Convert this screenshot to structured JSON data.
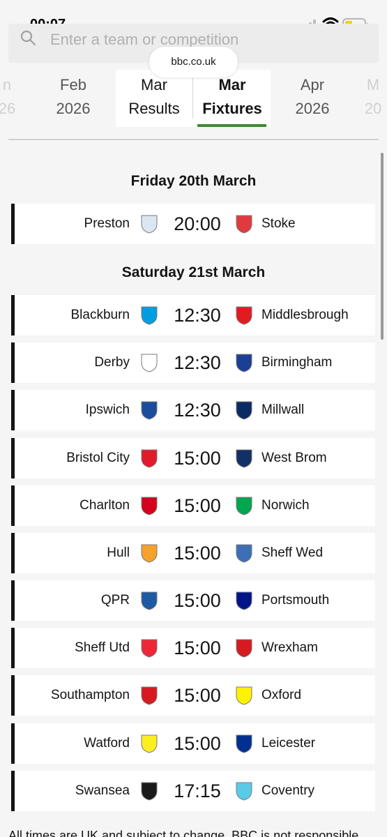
{
  "status_bar": {
    "time": "00:07"
  },
  "search": {
    "placeholder": "Enter a team or competition"
  },
  "browser": {
    "url": "bbc.co.uk"
  },
  "month_tabs": [
    {
      "line1": "n",
      "line2": "26"
    },
    {
      "line1": "Feb",
      "line2": "2026"
    },
    {
      "line1": "Mar",
      "line2": "Results"
    },
    {
      "line1": "Mar",
      "line2": "Fixtures"
    },
    {
      "line1": "Apr",
      "line2": "2026"
    },
    {
      "line1": "M",
      "line2": "20"
    }
  ],
  "days": [
    {
      "heading": "Friday 20th March",
      "fixtures": [
        {
          "home": "Preston",
          "time": "20:00",
          "away": "Stoke",
          "home_crest": "#dbe6f2",
          "away_crest": "#e03a3e"
        }
      ]
    },
    {
      "heading": "Saturday 21st March",
      "fixtures": [
        {
          "home": "Blackburn",
          "time": "12:30",
          "away": "Middlesbrough",
          "home_crest": "#009ee0",
          "away_crest": "#e11b22"
        },
        {
          "home": "Derby",
          "time": "12:30",
          "away": "Birmingham",
          "home_crest": "#ffffff",
          "away_crest": "#1b3f94"
        },
        {
          "home": "Ipswich",
          "time": "12:30",
          "away": "Millwall",
          "home_crest": "#1c4d9c",
          "away_crest": "#0b2a63"
        },
        {
          "home": "Bristol City",
          "time": "15:00",
          "away": "West Brom",
          "home_crest": "#e21b2c",
          "away_crest": "#122f67"
        },
        {
          "home": "Charlton",
          "time": "15:00",
          "away": "Norwich",
          "home_crest": "#d4021d",
          "away_crest": "#00a650"
        },
        {
          "home": "Hull",
          "time": "15:00",
          "away": "Sheff Wed",
          "home_crest": "#f5a12d",
          "away_crest": "#3d6fb6"
        },
        {
          "home": "QPR",
          "time": "15:00",
          "away": "Portsmouth",
          "home_crest": "#1d5ba4",
          "away_crest": "#001489"
        },
        {
          "home": "Sheff Utd",
          "time": "15:00",
          "away": "Wrexham",
          "home_crest": "#ee2737",
          "away_crest": "#d71920"
        },
        {
          "home": "Southampton",
          "time": "15:00",
          "away": "Oxford",
          "home_crest": "#d71920",
          "away_crest": "#fff200"
        },
        {
          "home": "Watford",
          "time": "15:00",
          "away": "Leicester",
          "home_crest": "#fbee23",
          "away_crest": "#003090"
        },
        {
          "home": "Swansea",
          "time": "17:15",
          "away": "Coventry",
          "home_crest": "#1a1a1a",
          "away_crest": "#59cbe8"
        }
      ]
    }
  ],
  "footer": {
    "note": "All times are UK and subject to change. BBC is not responsible"
  },
  "colors": {
    "accent": "#3c8a2e",
    "row_marker": "#141414"
  }
}
